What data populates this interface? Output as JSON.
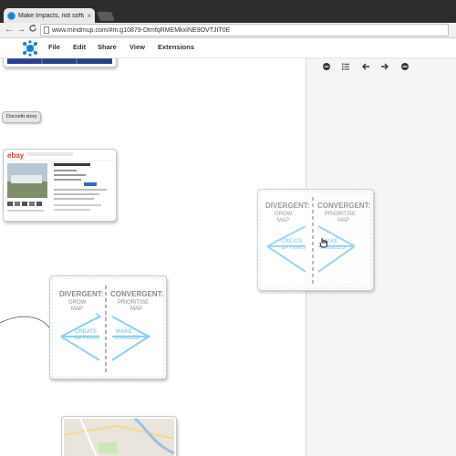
{
  "browser": {
    "tab_title": "Make Impacts, not softwa",
    "tab_close": "×",
    "url": "www.mindmup.com/#m:g10879-DtmfqRMEMkxINE9OVTJIT0E",
    "back": "←",
    "forward": "→",
    "reload": "C"
  },
  "app": {
    "menu": [
      "File",
      "Edit",
      "Share",
      "View",
      "Extensions"
    ]
  },
  "toolbar": {
    "tools": [
      "zoom-out",
      "list",
      "back",
      "forward",
      "zoom-in"
    ]
  },
  "canvas": {
    "story_node_label": "Doccetti story",
    "ebay_logo": "ebay"
  },
  "sketch": {
    "left_heading": "DIVERGENT:",
    "left_sub": "GROW\nMAP",
    "right_heading": "CONVERGENT:",
    "right_sub": "PRIORITISE\nMAP",
    "left_action": "CREATE\nOPTIONS",
    "right_action": "MAKE\nCHOICES"
  },
  "colors": {
    "accent": "#1d7fc8",
    "sketch_blue": "#8fd0ef",
    "sketch_text": "#8a8a8a"
  }
}
